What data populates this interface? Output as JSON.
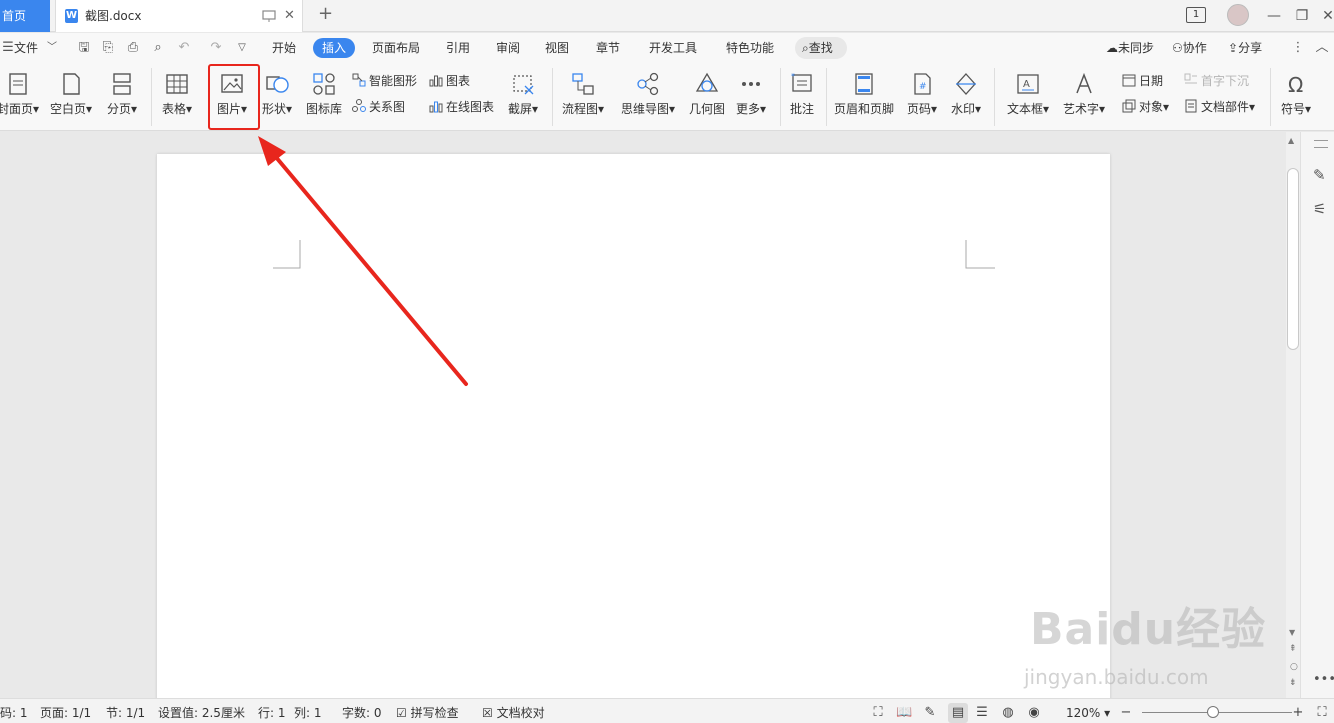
{
  "titlebar": {
    "home_tab": "首页",
    "doc_tab": "截图.docx",
    "new_tab": "+",
    "page_count_badge": "1"
  },
  "menu": {
    "file": "文件",
    "items": [
      "开始",
      "插入",
      "页面布局",
      "引用",
      "审阅",
      "视图",
      "章节",
      "开发工具",
      "特色功能"
    ],
    "active": "插入",
    "search": "查找",
    "sync": "未同步",
    "collab": "协作",
    "share": "分享"
  },
  "ribbon": {
    "cover": "封面页",
    "blank": "空白页",
    "pagebreak": "分页",
    "table": "表格",
    "picture": "图片",
    "shape": "形状",
    "iconlib": "图标库",
    "smartart": "智能图形",
    "relation": "关系图",
    "chart": "图表",
    "onlinechart": "在线图表",
    "screenshot": "截屏",
    "flowchart": "流程图",
    "mindmap": "思维导图",
    "geometry": "几何图",
    "more": "更多",
    "comment": "批注",
    "header_footer": "页眉和页脚",
    "page_number": "页码",
    "watermark": "水印",
    "textbox": "文本框",
    "wordart": "艺术字",
    "date": "日期",
    "object": "对象",
    "dropcap": "首字下沉",
    "docparts": "文档部件",
    "symbol": "符号"
  },
  "status": {
    "page_code": "码: 1",
    "page": "页面: 1/1",
    "section": "节: 1/1",
    "setting": "设置值: 2.5厘米",
    "row": "行: 1",
    "col": "列: 1",
    "words": "字数: 0",
    "spellcheck": "拼写检查",
    "proofread": "文档校对",
    "zoom": "120%"
  },
  "watermark": {
    "brand": "Baidu经验",
    "url": "jingyan.baidu.com"
  },
  "colors": {
    "accent": "#3a86ee",
    "highlight": "#e8261d"
  }
}
